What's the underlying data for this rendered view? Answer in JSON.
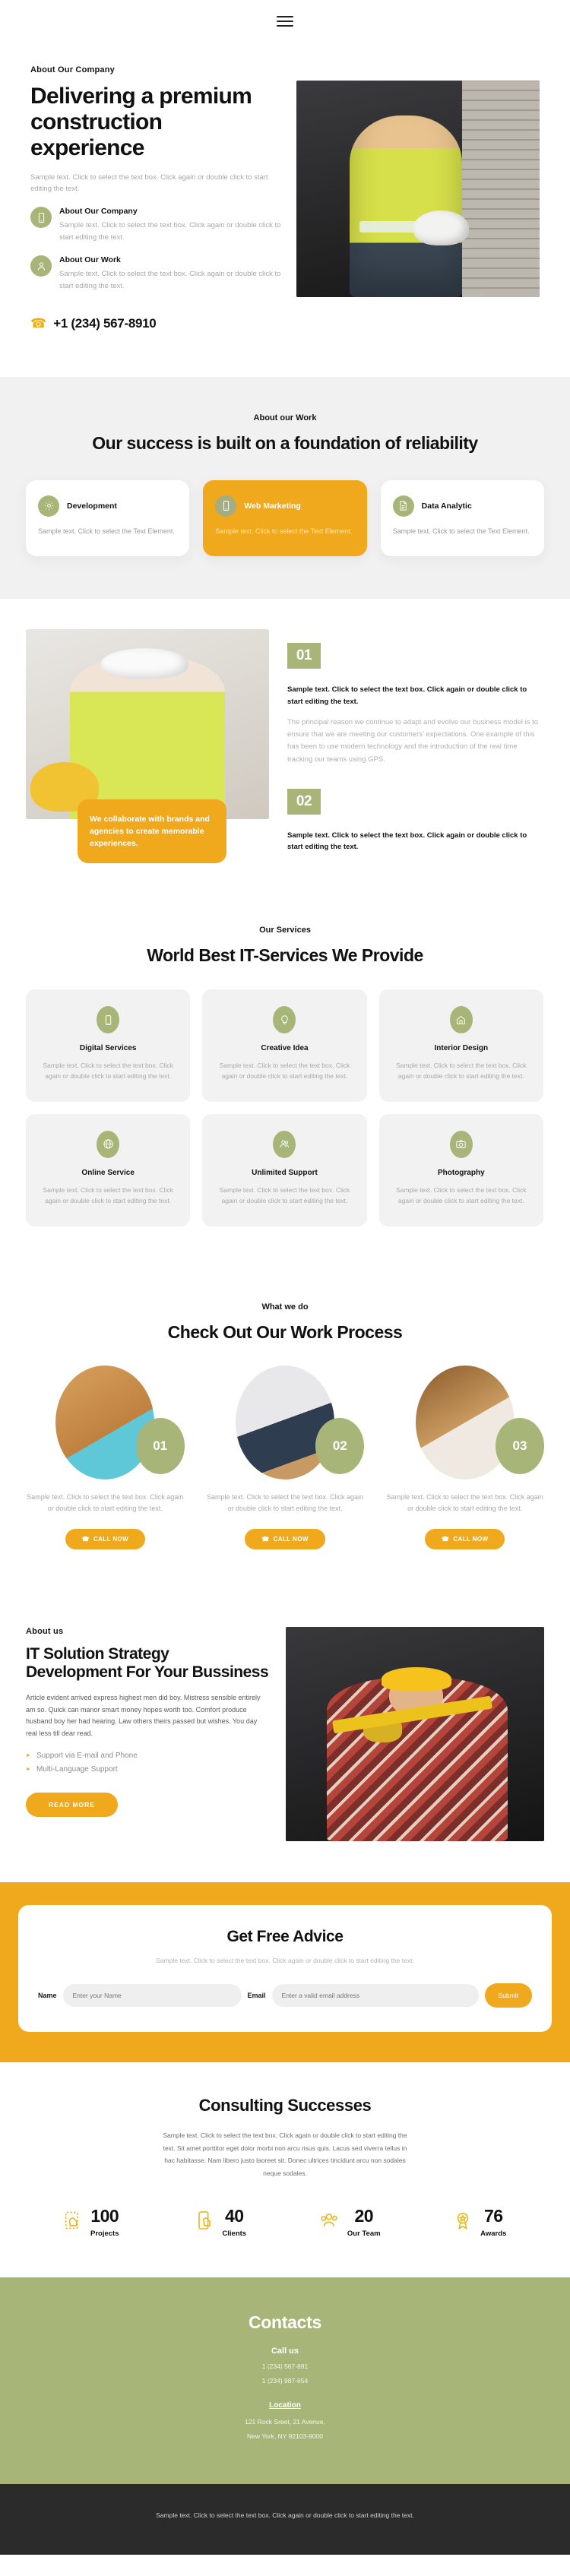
{
  "nav": {
    "menu_label": "menu-toggle"
  },
  "hero": {
    "eyebrow": "About Our Company",
    "title": "Delivering a premium construction experience",
    "body": "Sample text. Click to select the text box. Click again or double click to start editing the text.",
    "features": [
      {
        "icon": "mobile-icon",
        "title": "About Our Company",
        "body": "Sample text. Click to select the text box. Click again or double click to start editing the text."
      },
      {
        "icon": "user-icon",
        "title": "About Our Work",
        "body": "Sample text. Click to select the text box. Click again or double click to start editing the text."
      }
    ],
    "phone": "+1 (234) 567-8910",
    "phone_icon": "phone-icon"
  },
  "work": {
    "eyebrow": "About our Work",
    "title": "Our success is built on a foundation of reliability",
    "cards": [
      {
        "icon": "gear-icon",
        "title": "Development",
        "body": "Sample text. Click to select the Text Element.",
        "accent": false
      },
      {
        "icon": "mobile-icon",
        "title": "Web Marketing",
        "body": "Sample text. Click to select the Text Element.",
        "accent": true
      },
      {
        "icon": "document-icon",
        "title": "Data Analytic",
        "body": "Sample text. Click to select the Text Element.",
        "accent": false
      }
    ]
  },
  "numbered": {
    "quote": "We collaborate with brands and agencies to create memorable experiences.",
    "items": [
      {
        "number": "01",
        "strong": "Sample text. Click to select the text box. Click again or double click to start editing the text.",
        "para": "The principal reason we continue to adapt and evolve our business model is to ensure that we are meeting our customers’ expectations. One example of this has been to use modern technology and the introduction of the real time tracking our teams using GPS."
      },
      {
        "number": "02",
        "strong": "Sample text. Click to select the text box. Click again or double click to start editing the text.",
        "para": ""
      }
    ]
  },
  "services": {
    "eyebrow": "Our Services",
    "title": "World Best IT-Services We Provide",
    "cards": [
      {
        "icon": "mobile-icon",
        "title": "Digital Services",
        "body": "Sample text. Click to select the text box. Click again or double click to start editing the text."
      },
      {
        "icon": "bulb-icon",
        "title": "Creative Idea",
        "body": "Sample text. Click to select the text box. Click again or double click to start editing the text."
      },
      {
        "icon": "house-icon",
        "title": "Interior Design",
        "body": "Sample text. Click to select the text box. Click again or double click to start editing the text."
      },
      {
        "icon": "globe-icon",
        "title": "Online Service",
        "body": "Sample text. Click to select the text box. Click again or double click to start editing the text."
      },
      {
        "icon": "people-icon",
        "title": "Unlimited Support",
        "body": "Sample text. Click to select the text box. Click again or double click to start editing the text."
      },
      {
        "icon": "camera-icon",
        "title": "Photography",
        "body": "Sample text. Click to select the text box. Click again or double click to start editing the text."
      }
    ]
  },
  "process": {
    "eyebrow": "What we do",
    "title": "Check Out Our Work Process",
    "steps": [
      {
        "number": "01",
        "body": "Sample text. Click to select the text box. Click again or double click to start editing the text.",
        "button": "CALL NOW"
      },
      {
        "number": "02",
        "body": "Sample text. Click to select the text box. Click again or double click to start editing the text.",
        "button": "CALL NOW"
      },
      {
        "number": "03",
        "body": "Sample text. Click to select the text box. Click again or double click to start editing the text.",
        "button": "CALL NOW"
      }
    ]
  },
  "about": {
    "eyebrow": "About us",
    "title": "IT Solution Strategy Development For Your Bussiness",
    "para": "Article evident arrived express highest men did boy. Mistress sensible entirely am so. Quick can manor smart money hopes worth too. Comfort produce husband boy her had hearing. Law others theirs passed but wishes. You day real less till dear read.",
    "bullets": [
      "Support via E-mail and Phone",
      "Multi-Language Support"
    ],
    "button": "READ MORE"
  },
  "advice": {
    "title": "Get Free Advice",
    "sub": "Sample text. Click to select the text box. Click again or double click to start editing the text.",
    "name_label": "Name",
    "name_placeholder": "Enter your Name",
    "email_label": "Email",
    "email_placeholder": "Enter a valid email address",
    "submit": "Submit"
  },
  "stats": {
    "title": "Consulting Successes",
    "sub": "Sample text. Click to select the text box. Click again or double click to start editing the text. Sit amet porttitor eget dolor morbi non arcu risus quis. Lacus sed viverra tellus in hac habitasse. Nam libero justo laoreet sit. Donec ultrices tincidunt arcu non sodales neque sodales.",
    "items": [
      {
        "icon": "hand-card-icon",
        "value": "100",
        "label": "Projects"
      },
      {
        "icon": "mobile-tap-icon",
        "value": "40",
        "label": "Clients"
      },
      {
        "icon": "people-icon",
        "value": "20",
        "label": "Our Team"
      },
      {
        "icon": "award-icon",
        "value": "76",
        "label": "Awards"
      }
    ]
  },
  "contacts": {
    "title": "Contacts",
    "call_label": "Call us",
    "phones": [
      "1 (234) 567-891",
      "1 (234) 987-654"
    ],
    "location_label": "Location",
    "address_lines": [
      "121 Rock Sreet, 21 Avenue,",
      "New York, NY 92103-9000"
    ]
  },
  "footer": {
    "text": "Sample text. Click to select the text box. Click again or double click to start editing the text."
  },
  "colors": {
    "accent_orange": "#f0a81c",
    "accent_green": "#a8b578",
    "gray_bg": "#f1f1f1",
    "dark_footer": "#2b2b2b"
  }
}
